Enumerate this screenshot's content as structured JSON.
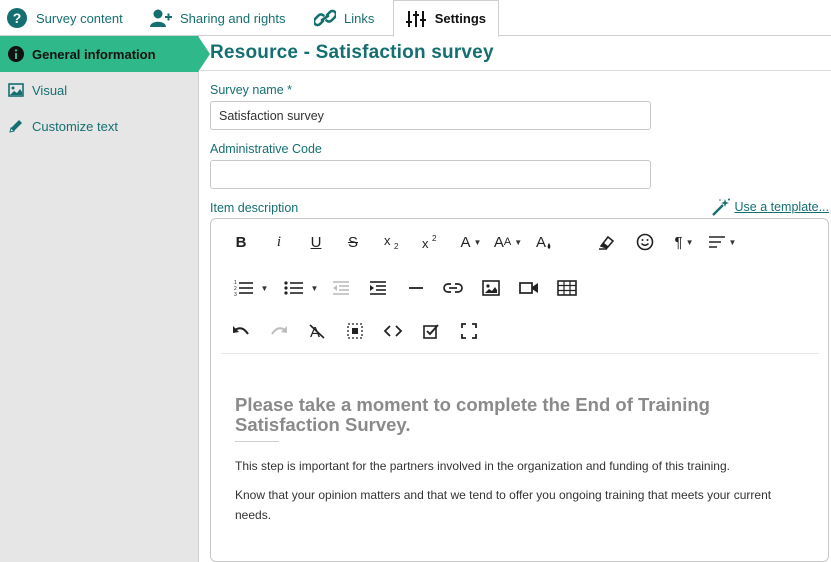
{
  "tabs": [
    {
      "label": "Survey content",
      "icon": "question-circle-icon"
    },
    {
      "label": "Sharing and rights",
      "icon": "user-plus-icon"
    },
    {
      "label": "Links",
      "icon": "link-icon"
    },
    {
      "label": "Settings",
      "icon": "sliders-icon",
      "active": true
    }
  ],
  "sidebar": {
    "items": [
      {
        "label": "General information",
        "icon": "info-circle-icon",
        "active": true
      },
      {
        "label": "Visual",
        "icon": "image-icon"
      },
      {
        "label": "Customize text",
        "icon": "pencil-icon"
      }
    ]
  },
  "main": {
    "title": "Resource - Satisfaction survey",
    "survey_name": {
      "label": "Survey name *",
      "value": "Satisfaction survey"
    },
    "admin_code": {
      "label": "Administrative Code",
      "value": ""
    },
    "item_description": {
      "label": "Item description"
    },
    "template_link": "Use a template..."
  },
  "editor": {
    "toolbar_row1": [
      "bold",
      "italic",
      "underline",
      "strikethrough",
      "subscript",
      "superscript",
      "font-color",
      "font-size",
      "fill-color",
      "clear-format",
      "emoticons",
      "paragraph-format",
      "align"
    ],
    "toolbar_row2": [
      "ordered-list",
      "unordered-list",
      "outdent",
      "indent",
      "horizontal-line",
      "insert-link",
      "insert-image",
      "insert-video",
      "insert-table"
    ],
    "toolbar_row3": [
      "undo",
      "redo",
      "clear-formatting",
      "select-all",
      "code-view",
      "spellcheck",
      "fullscreen"
    ],
    "content": {
      "heading": "Please take a moment to complete the End of Training Satisfaction Survey.",
      "paragraph1": "This step is important for the partners involved in the organization and funding of this training.",
      "paragraph2": "Know that your opinion matters and that we tend to offer you ongoing training that meets your current needs."
    }
  },
  "colors": {
    "accent": "#156f70",
    "active_green": "#2fb88a",
    "sidebar_bg": "#e6e6e6"
  }
}
